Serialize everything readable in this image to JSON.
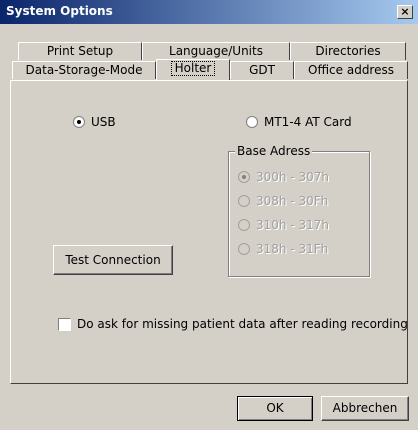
{
  "window": {
    "title": "System Options",
    "close_icon": "close-icon"
  },
  "tabs": {
    "row1": [
      {
        "label": "Print Setup"
      },
      {
        "label": "Language/Units"
      },
      {
        "label": "Directories"
      }
    ],
    "row2": [
      {
        "label": "Data-Storage-Mode"
      },
      {
        "label": "Holter"
      },
      {
        "label": "GDT"
      },
      {
        "label": "Office address"
      }
    ],
    "active": "Holter"
  },
  "holter": {
    "usb_label": "USB",
    "usb_selected": true,
    "mt_label": "MT1-4 AT Card",
    "mt_selected": false,
    "base_address": {
      "label": "Base Adress",
      "options": [
        "300h - 307h",
        "308h - 30Fh",
        "310h - 317h",
        "318h - 31Fh"
      ],
      "selected_index": 0,
      "enabled": false
    },
    "test_button": "Test Connection",
    "ask_checkbox_label": "Do ask for missing patient data after reading recording",
    "ask_checked": false
  },
  "footer": {
    "ok_label": "OK",
    "cancel_label": "Abbrechen"
  }
}
